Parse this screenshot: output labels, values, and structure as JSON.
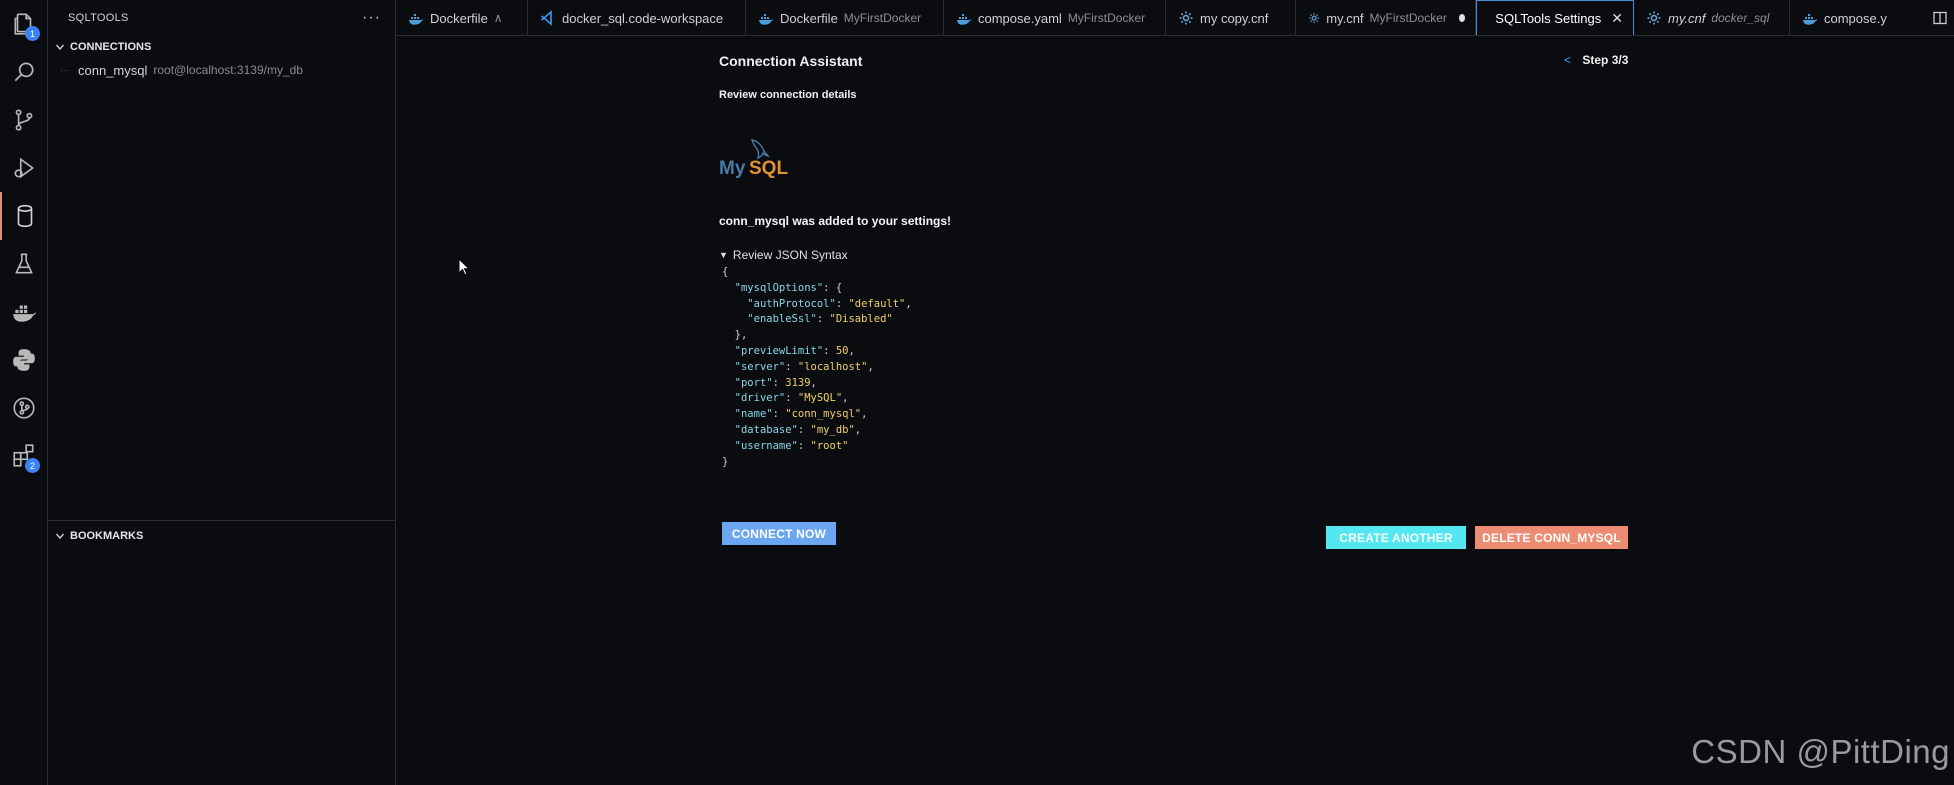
{
  "activity_bar": {
    "items": [
      {
        "icon": "explorer-icon",
        "badge": "1"
      },
      {
        "icon": "search-icon"
      },
      {
        "icon": "source-control-icon"
      },
      {
        "icon": "run-debug-icon"
      },
      {
        "icon": "database-icon"
      },
      {
        "icon": "testing-flask-icon"
      },
      {
        "icon": "docker-icon"
      },
      {
        "icon": "python-icon"
      },
      {
        "icon": "git-graph-icon"
      },
      {
        "icon": "extensions-icon",
        "badge": "2"
      }
    ]
  },
  "sidebar": {
    "title": "SQLTOOLS",
    "connections_header": "CONNECTIONS",
    "connections": [
      {
        "name": "conn_mysql",
        "description": "root@localhost:3139/my_db"
      }
    ],
    "bookmarks_header": "BOOKMARKS"
  },
  "tabs": [
    {
      "label": "Dockerfile",
      "description": "∧",
      "icon": "docker-icon"
    },
    {
      "label": "docker_sql.code-workspace",
      "description": "",
      "icon": "vscode-icon"
    },
    {
      "label": "Dockerfile",
      "description": "MyFirstDocker",
      "icon": "docker-icon"
    },
    {
      "label": "compose.yaml",
      "description": "MyFirstDocker",
      "icon": "docker-icon"
    },
    {
      "label": "my copy.cnf",
      "description": "",
      "icon": "gear-icon"
    },
    {
      "label": "my.cnf",
      "description": "MyFirstDocker",
      "icon": "gear-icon"
    },
    {
      "label": "SQLTools Settings",
      "description": "",
      "icon": "database-icon"
    },
    {
      "label": "my.cnf",
      "description": "docker_sql",
      "icon": "gear-icon"
    },
    {
      "label": "compose.y",
      "description": "",
      "icon": "docker-icon"
    }
  ],
  "wizard": {
    "title": "Connection Assistant",
    "step_back": "<",
    "step": "Step 3/3",
    "subtitle": "Review connection details",
    "logo_text_my": "My",
    "logo_text_sql": "SQL",
    "added_message": "conn_mysql was added to your settings!",
    "json_toggle": "Review JSON Syntax",
    "buttons": {
      "connect": "CONNECT NOW",
      "create": "CREATE ANOTHER",
      "delete": "DELETE CONN_MYSQL"
    }
  },
  "json_lines": {
    "open": "{",
    "l1_key": "\"mysqlOptions\"",
    "l1_rest": ": {",
    "l2_key": "\"authProtocol\"",
    "l2_val": "\"default\"",
    "l3_key": "\"enableSsl\"",
    "l3_val": "\"Disabled\"",
    "l4": "},",
    "l5_key": "\"previewLimit\"",
    "l5_val": "50",
    "l6_key": "\"server\"",
    "l6_val": "\"localhost\"",
    "l7_key": "\"port\"",
    "l7_val": "3139",
    "l8_key": "\"driver\"",
    "l8_val": "\"MySQL\"",
    "l9_key": "\"name\"",
    "l9_val": "\"conn_mysql\"",
    "l10_key": "\"database\"",
    "l10_val": "\"my_db\"",
    "l11_key": "\"username\"",
    "l11_val": "\"root\"",
    "close": "}"
  },
  "watermark": "CSDN @PittDing",
  "colors": {
    "background": "#0b0c10",
    "accent_blue": "#4a8fd6",
    "connect_button": "#6aa7f0",
    "create_button": "#54e6f1",
    "delete_button": "#ec8d73",
    "json_key": "#8ad6e8",
    "json_value": "#f2d16b"
  }
}
